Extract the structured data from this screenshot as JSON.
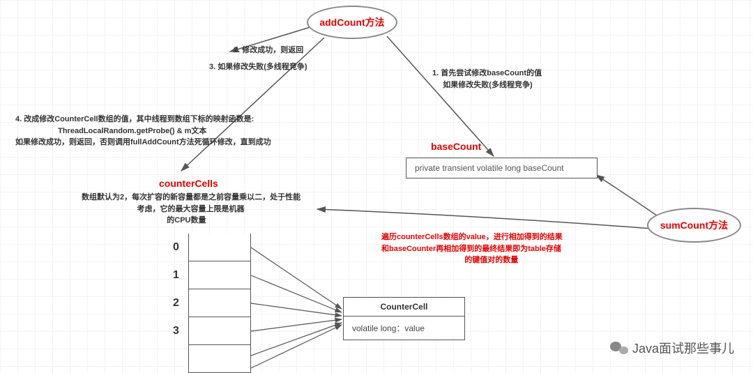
{
  "ellipses": {
    "addCount": "addCount方法",
    "sumCount": "sumCount方法"
  },
  "headings": {
    "baseCount": "baseCount",
    "counterCells": "counterCells"
  },
  "labels": {
    "step1": "1. 首先尝试修改baseCount的值\n     如果修改失败(多线程竞争)",
    "step2": "2. 修改成功，则返回",
    "step3": "3. 如果修改失败(多线程竞争)",
    "step4": "4. 改成修改CounterCell数组的值，其中线程到数组下标的映射函数是:\n                    ThreadLocalRandom.getProbe() & m文本\n如果修改成功，则返回，否则调用fullAddCount方法死循环修改，直到成功",
    "counterCellsDesc": "数组默认为2，每次扩容的新容量都是之前容量乘以二，处于性能\n                          考虑，它的最大容量上限是机器\n                                        的CPU数量",
    "sumDesc": "遍历counterCells数组的value，进行相加得到的结果\n和baseCounter再相加得到的最终结果即为table存储\n                                       的键值对的数量"
  },
  "baseCountBox": "private transient volatile long baseCount",
  "counterCellClass": {
    "name": "CounterCell",
    "field": "volatile long：value"
  },
  "arrayIndexes": [
    "0",
    "1",
    "2",
    "3"
  ],
  "watermark": "Java面试那些事儿"
}
